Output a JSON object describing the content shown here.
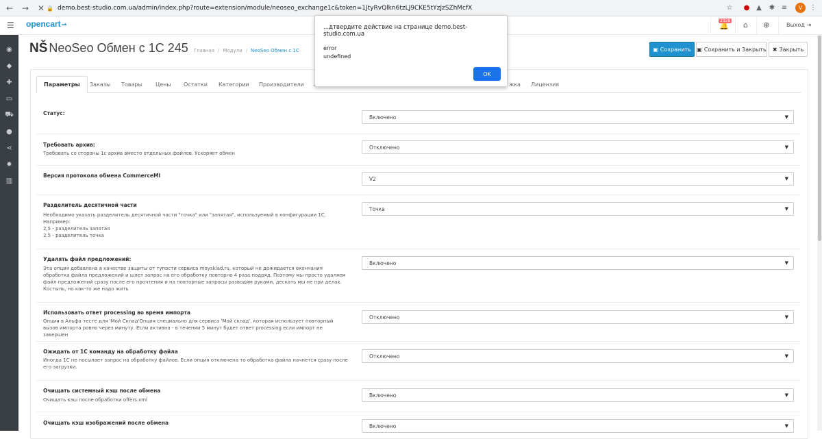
{
  "browser": {
    "url": "demo.best-studio.com.ua/admin/index.php?route=extension/module/neoseo_exchange1c&token=1JtyRvQlkn6tzLJ9CKE5tYzJzSZhMcfX",
    "profile_initial": "V"
  },
  "header": {
    "logo": "opencart",
    "notification_count": "2328",
    "logout_label": "Выход"
  },
  "page": {
    "title_logo": "NŠ",
    "title": "NeoSeo Обмен с 1С 245",
    "breadcrumb": [
      "Главная",
      "Модули",
      "NeoSeo Обмен с 1С"
    ]
  },
  "buttons": {
    "save": "Сохранить",
    "save_close": "Сохранить и Закрыть",
    "close": "Закрыть"
  },
  "tabs": [
    "Параметры",
    "Заказы",
    "Товары",
    "Цены",
    "Остатки",
    "Категории",
    "Производители",
    "А",
    "жка",
    "Лицензия"
  ],
  "rows": [
    {
      "label": "Статус:",
      "help": "",
      "value": "Включено"
    },
    {
      "label": "Требовать архив:",
      "help": "Требовать со стороны 1с архив вместо отдельных файлов. Ускоряет обмен",
      "value": "Отключено"
    },
    {
      "label": "Версия протокола обмена CommerceMl",
      "help": "",
      "value": "V2"
    },
    {
      "label": "Разделитель десятичной части",
      "help": "Необходимо указать разделитель десятичной части \"точка\" или \"запятая\", используемый в конфигурации 1С.\nНапример:\n2,5 - разделитель запятая\n2.5 - разделитель точка",
      "value": "Точка"
    },
    {
      "label": "Удалять файл предложений:",
      "help": "Эта опция добавлена в качестве защиты от тупости сервиса moysklad.ru, который не дожидается окончания обработка файла предложений и шлет запрос на его обработку повторно 4 раза подряд. Поэтому мы просто удаляем файл предложений сразу после его прочтения и на повторные запросы разводим руками, дескать мы не при делах. Костыль, но как-то же надо жить",
      "value": "Включено"
    },
    {
      "label": "Использовать ответ processing во время импорта",
      "help": "Опция в Альфа тесте для 'Мой Склад'Опция специально для сервиса 'Мой склад', которая использует повторный вызов импорта ровно через минуту. Если активна - в течении 5 минут будет ответ processing если импорт не завершен",
      "value": "Отключено"
    },
    {
      "label": "Ожидать от 1С команду на обработку файла",
      "help": "Иногда 1С не посылает запрос на обработку файлов. Если опция отключена то обработка файла начнется сразу после его загрузки.",
      "value": "Отключено"
    },
    {
      "label": "Очищать системный кэш после обмена",
      "help": "Очищать кэш после обработки offers.xml",
      "value": "Включено"
    },
    {
      "label": "Очищать кэш изображений после обмена",
      "help": "",
      "value": "Включено"
    }
  ],
  "dialog": {
    "title": "...дтвердите действие на странице demo.best-studio.com.ua",
    "message": "error\nundefined",
    "ok": "OK"
  }
}
